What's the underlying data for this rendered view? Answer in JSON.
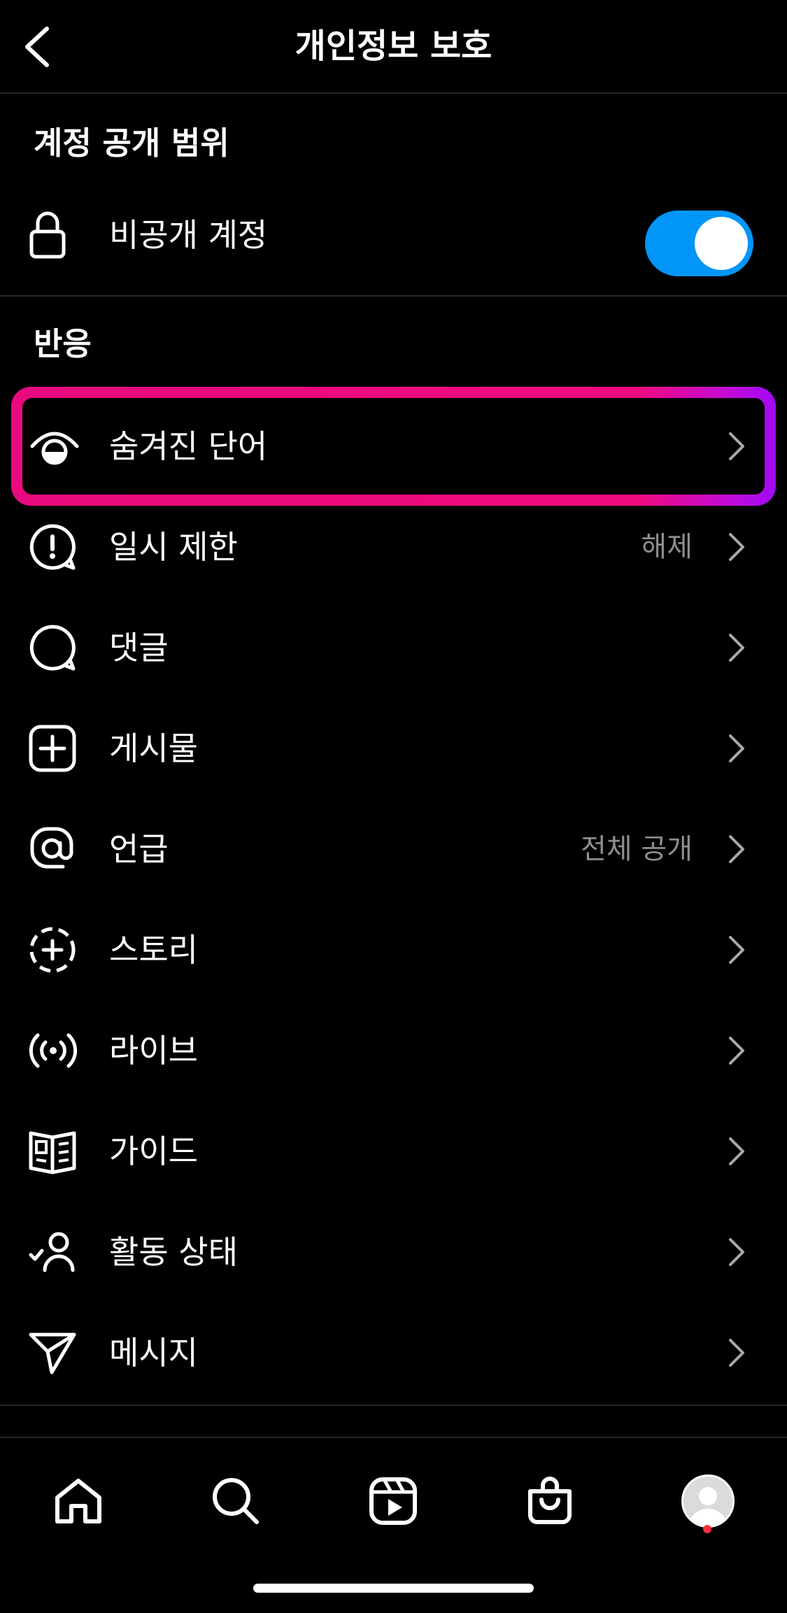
{
  "header": {
    "title": "개인정보 보호"
  },
  "account_section": {
    "title": "계정 공개 범위",
    "private_account": {
      "label": "비공개 계정",
      "enabled": true,
      "icon": "lock-icon"
    }
  },
  "interactions_section": {
    "title": "반응",
    "items": [
      {
        "id": "hidden-words",
        "label": "숨겨진 단어",
        "value": "",
        "icon": "hidden-words-icon"
      },
      {
        "id": "limits",
        "label": "일시 제한",
        "value": "해제",
        "icon": "alert-bubble-icon"
      },
      {
        "id": "comments",
        "label": "댓글",
        "value": "",
        "icon": "comment-icon"
      },
      {
        "id": "posts",
        "label": "게시물",
        "value": "",
        "icon": "plus-square-icon"
      },
      {
        "id": "mentions",
        "label": "언급",
        "value": "전체 공개",
        "icon": "at-sign-icon"
      },
      {
        "id": "story",
        "label": "스토리",
        "value": "",
        "icon": "story-add-icon"
      },
      {
        "id": "live",
        "label": "라이브",
        "value": "",
        "icon": "live-broadcast-icon"
      },
      {
        "id": "guides",
        "label": "가이드",
        "value": "",
        "icon": "guide-book-icon"
      },
      {
        "id": "activity-status",
        "label": "활동 상태",
        "value": "",
        "icon": "user-check-icon"
      },
      {
        "id": "messages",
        "label": "메시지",
        "value": "",
        "icon": "paper-plane-icon"
      }
    ]
  },
  "tabbar": {
    "items": [
      "home-icon",
      "search-icon",
      "reels-icon",
      "shop-icon",
      "profile-avatar"
    ]
  },
  "colors": {
    "background": "#000000",
    "toggle_on": "#0095f6",
    "highlight": "#ef0b7f",
    "secondary_text": "#8e8e8e",
    "notification": "#ff3040"
  }
}
